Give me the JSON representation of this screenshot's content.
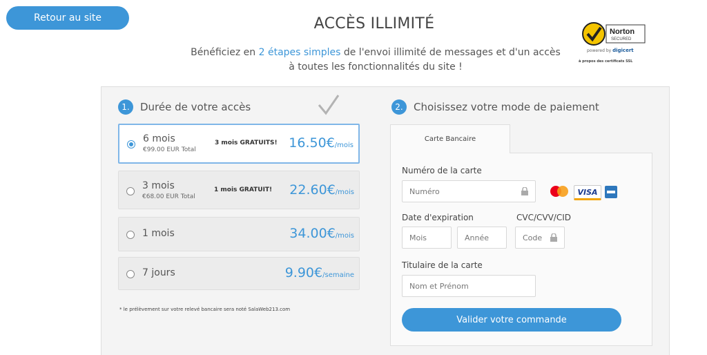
{
  "header": {
    "back_label": "Retour au site",
    "title": "ACCÈS ILLIMITÉ",
    "subtitle_pre": "Bénéficiez en ",
    "subtitle_highlight": "2 étapes simples",
    "subtitle_post": " de l'envoi illimité de messages et d'un accès",
    "subtitle_line2": "à toutes les fonctionnalités du site !"
  },
  "norton": {
    "badge_text": "Norton",
    "badge_sub": "SECURED",
    "powered_by": "powered by",
    "powered_brand": "digicert",
    "ssl_link": "à propos des certificats SSL"
  },
  "step1": {
    "number": "1.",
    "title": "Durée de votre accès",
    "plans": [
      {
        "name": "6 mois",
        "total": "€99.00 EUR Total",
        "promo": "3 mois GRATUITS!",
        "price": "16.50€",
        "unit": "/mois",
        "selected": true
      },
      {
        "name": "3 mois",
        "total": "€68.00 EUR Total",
        "promo": "1 mois GRATUIT!",
        "price": "22.60€",
        "unit": "/mois",
        "selected": false
      },
      {
        "name": "1 mois",
        "total": "",
        "promo": "",
        "price": "34.00€",
        "unit": "/mois",
        "selected": false
      },
      {
        "name": "7 jours",
        "total": "",
        "promo": "",
        "price": "9.90€",
        "unit": "/semaine",
        "selected": false
      }
    ],
    "note": "* le prélèvement sur votre relevé bancaire sera noté SalaWeb213.com"
  },
  "step2": {
    "number": "2.",
    "title": "Choisissez votre mode de paiement",
    "tab_label": "Carte Bancaire",
    "card_number_label": "Numéro de la carte",
    "card_number_placeholder": "Numéro",
    "expiry_label": "Date d'expiration",
    "month_placeholder": "Mois",
    "year_placeholder": "Année",
    "cvc_label": "CVC/CVV/CID",
    "cvc_placeholder": "Code",
    "holder_label": "Titulaire de la carte",
    "holder_placeholder": "Nom et Prénom",
    "visa_text": "VISA",
    "submit_label": "Valider votre commande"
  },
  "colors": {
    "accent": "#3d96d8",
    "selected_border": "#7fb6e8",
    "panel_bg": "#f4f4f4"
  }
}
